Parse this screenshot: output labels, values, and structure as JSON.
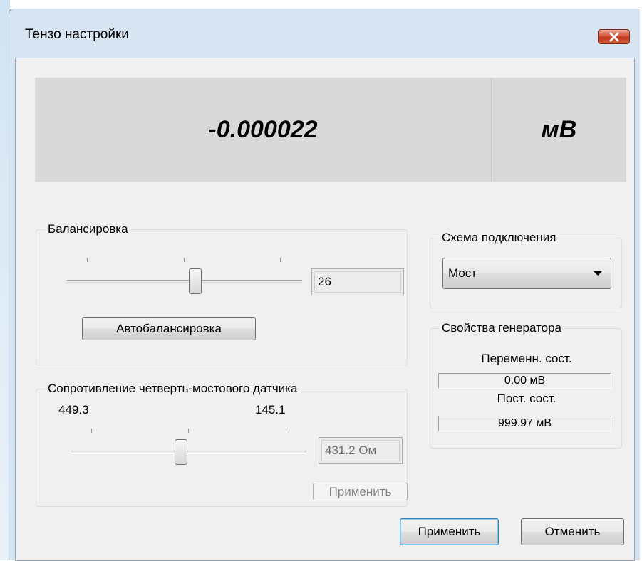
{
  "window": {
    "title": "Тензо настройки"
  },
  "display": {
    "value": "-0.000022",
    "unit": "мВ"
  },
  "balance": {
    "legend": "Балансировка",
    "slider_value": 26,
    "field_value": "26",
    "auto_button": "Автобалансировка"
  },
  "resistance": {
    "legend": "Сопротивление четверть-мостового датчика",
    "min_label": "449.3",
    "max_label": "145.1",
    "field_value": "431.2 Ом",
    "apply_button": "Применить"
  },
  "connection": {
    "legend": "Схема подключения",
    "selected": "Мост"
  },
  "generator": {
    "legend": "Свойства генератора",
    "ac_label": "Переменн. сост.",
    "ac_value": "0.00 мВ",
    "dc_label": "Пост. сост.",
    "dc_value": "999.97 мВ"
  },
  "footer": {
    "apply": "Применить",
    "cancel": "Отменить"
  },
  "colors": {
    "titlebar": "#d7e4f2",
    "close": "#c7391c",
    "display_bg": "#d9d9d9",
    "default_button_border": "#3c7fb1"
  }
}
